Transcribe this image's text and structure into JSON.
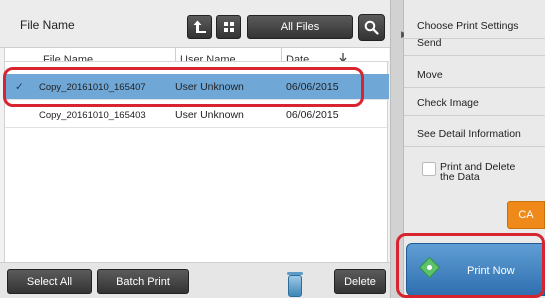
{
  "header": {
    "title": "File Name",
    "filter_label": "All Files",
    "upload_icon": "upload-arrow-icon",
    "grid_icon": "grid-view-icon",
    "search_icon": "search-icon"
  },
  "table": {
    "columns": [
      "File Name",
      "User Name",
      "Date"
    ],
    "sort_icon": "sort-down-icon",
    "rows": [
      {
        "file": "Copy_20161010_165407",
        "user": "User Unknown",
        "date": "06/06/2015",
        "selected": true
      },
      {
        "file": "Copy_20161010_165403",
        "user": "User Unknown",
        "date": "06/06/2015",
        "selected": false
      }
    ]
  },
  "bottom": {
    "select_all": "Select All",
    "batch_print": "Batch Print",
    "delete": "Delete",
    "trash_icon": "trash-can-icon"
  },
  "side_menu": {
    "items": [
      "Choose Print Settings",
      "Send",
      "Move",
      "Check Image",
      "See Detail Information"
    ],
    "print_delete_line1": "Print and Delete",
    "print_delete_line2": "the Data",
    "ca_label": "CA",
    "print_now": "Print Now",
    "collapse_icon": "collapse-arrow-icon",
    "start_icon": "start-diamond-icon"
  },
  "colors": {
    "selection": "#6fa7d6",
    "highlight_border": "#d8242e",
    "ca_button": "#ef8a1a",
    "print_button": "#2f6fb0"
  }
}
